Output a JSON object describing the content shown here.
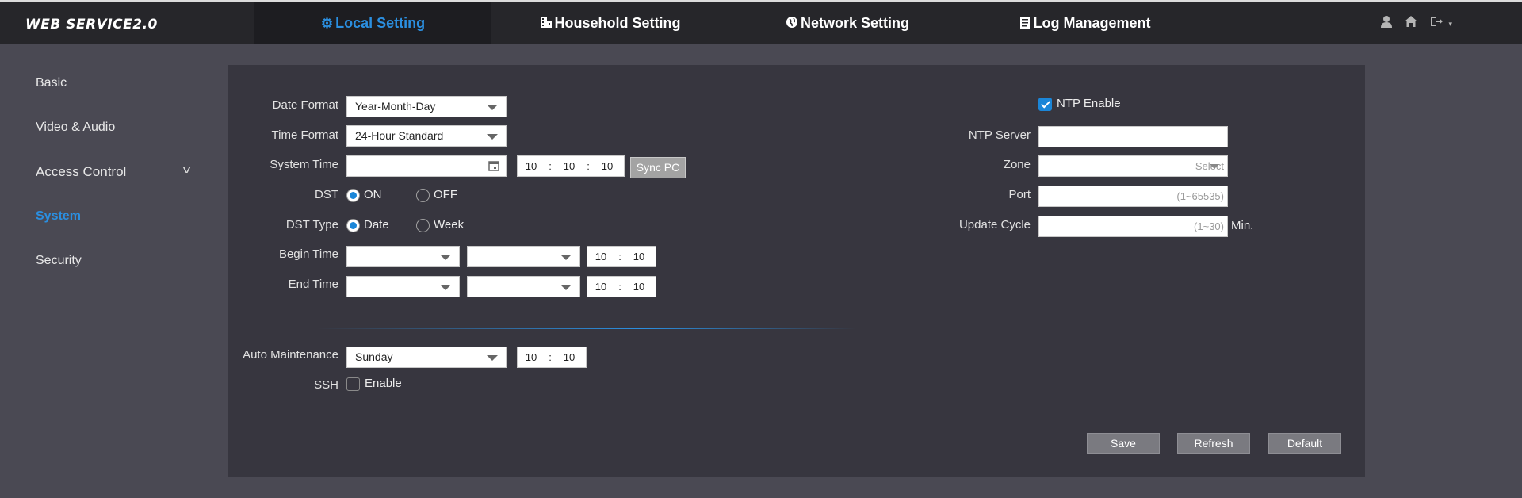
{
  "app": {
    "logo": "WEB SERVICE2.0"
  },
  "nav": {
    "tabs": [
      {
        "label": "Local Setting",
        "icon": "gear-icon",
        "active": true
      },
      {
        "label": "Household Setting",
        "icon": "building-icon",
        "active": false
      },
      {
        "label": "Network Setting",
        "icon": "globe-icon",
        "active": false
      },
      {
        "label": "Log Management",
        "icon": "document-icon",
        "active": false
      }
    ],
    "right_icons": [
      "user-icon",
      "home-icon",
      "logout-icon"
    ]
  },
  "sidebar": {
    "items": [
      {
        "label": "Basic"
      },
      {
        "label": "Video & Audio"
      },
      {
        "label": "Access Control",
        "expandable": true
      },
      {
        "label": "System",
        "active": true
      },
      {
        "label": "Security"
      }
    ]
  },
  "form": {
    "date_format": {
      "label": "Date Format",
      "value": "Year-Month-Day"
    },
    "time_format": {
      "label": "Time Format",
      "value": "24-Hour Standard"
    },
    "system_time": {
      "label": "System Time",
      "date": "",
      "hour": "10",
      "minute": "10",
      "second": "10",
      "sync_label": "Sync PC"
    },
    "dst": {
      "label": "DST",
      "on_label": "ON",
      "off_label": "OFF",
      "selected": "ON"
    },
    "dst_type": {
      "label": "DST Type",
      "date_label": "Date",
      "week_label": "Week",
      "selected": "Date"
    },
    "begin_time": {
      "label": "Begin Time",
      "hour": "10",
      "minute": "10"
    },
    "end_time": {
      "label": "End Time",
      "hour": "10",
      "minute": "10"
    },
    "auto_maintenance": {
      "label": "Auto Maintenance",
      "value": "Sunday",
      "hour": "10",
      "minute": "10"
    },
    "ssh": {
      "label": "SSH",
      "enable_label": "Enable",
      "checked": false
    }
  },
  "ntp": {
    "enable_label": "NTP Enable",
    "enabled": true,
    "server_label": "NTP Server",
    "server_value": "",
    "zone_label": "Zone",
    "zone_placeholder": "Select",
    "port_label": "Port",
    "port_placeholder": "(1~65535)",
    "update_cycle_label": "Update Cycle",
    "update_cycle_placeholder": "(1~30)",
    "update_cycle_unit": "Min."
  },
  "actions": {
    "save": "Save",
    "refresh": "Refresh",
    "default": "Default"
  },
  "colors": {
    "accent": "#2b8fe0",
    "topbar": "#26262a",
    "panel": "#37363f",
    "background": "#4a4953"
  }
}
